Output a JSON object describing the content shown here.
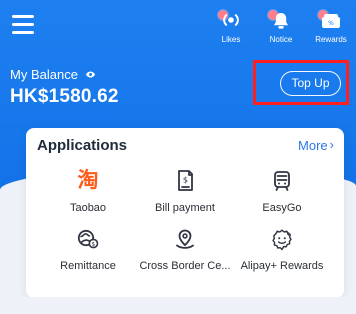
{
  "top_actions": {
    "likes_label": "Likes",
    "notice_label": "Notice",
    "rewards_label": "Rewards"
  },
  "balance": {
    "title": "My Balance",
    "amount": "HK$1580.62",
    "top_up_label": "Top Up"
  },
  "applications": {
    "title": "Applications",
    "more_label": "More",
    "items": [
      {
        "label": "Taobao",
        "icon": "taobao-icon"
      },
      {
        "label": "Bill payment",
        "icon": "bill-payment-icon"
      },
      {
        "label": "EasyGo",
        "icon": "bus-icon"
      },
      {
        "label": "Remittance",
        "icon": "remittance-icon"
      },
      {
        "label": "Cross Border Ce...",
        "icon": "location-pin-icon"
      },
      {
        "label": "Alipay+ Rewards",
        "icon": "reward-emoji-icon"
      }
    ]
  },
  "colors": {
    "primary_blue": "#1779ec",
    "highlight_red": "#ff1f1f",
    "taobao_orange": "#ff5b19",
    "link_blue": "#2c77e8"
  },
  "taobao_glyph": "淘"
}
